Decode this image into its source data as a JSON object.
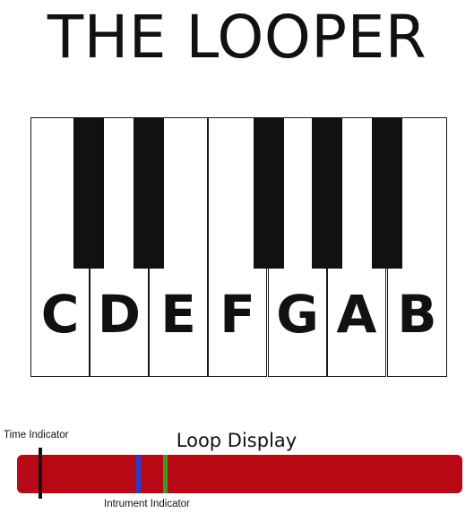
{
  "title": "THE LOOPER",
  "piano": {
    "keys": [
      {
        "note": "C"
      },
      {
        "note": "D"
      },
      {
        "note": "E"
      },
      {
        "note": "F"
      },
      {
        "note": "G"
      },
      {
        "note": "A"
      },
      {
        "note": "B"
      }
    ]
  },
  "loop_display": {
    "title": "Loop Display",
    "time_indicator_label": "Time Indicator",
    "instrument_indicator_label": "Intrument Indicator",
    "bar_color": "#b80916",
    "time_indicator_color": "#111111",
    "instrument_markers": [
      {
        "color": "#1f3fd6"
      },
      {
        "color": "#3a9a22"
      }
    ]
  }
}
